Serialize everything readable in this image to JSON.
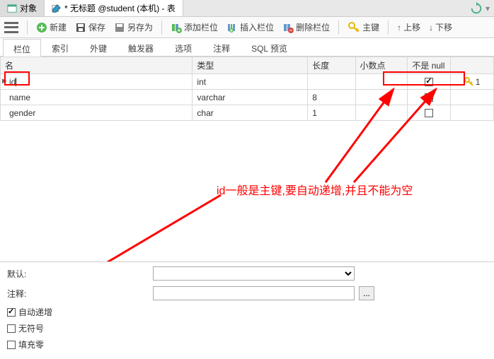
{
  "tabs": {
    "obj": "对象",
    "current": "* 无标题 @student (本机) - 表"
  },
  "toolbar": {
    "new": "新建",
    "save": "保存",
    "saveas": "另存为",
    "addcol": "添加栏位",
    "insertcol": "插入栏位",
    "delcol": "删除栏位",
    "pk": "主键",
    "moveup": "上移",
    "movedown": "下移"
  },
  "subtabs": {
    "fields": "栏位",
    "index": "索引",
    "fk": "外键",
    "trigger": "触发器",
    "options": "选项",
    "comment": "注释",
    "sql": "SQL 预览"
  },
  "headers": {
    "name": "名",
    "type": "类型",
    "len": "长度",
    "dec": "小数点",
    "nn": "不是 null"
  },
  "rows": [
    {
      "name": "id",
      "type": "int",
      "len": "",
      "dec": "",
      "nn": true,
      "pk": "1",
      "current": true
    },
    {
      "name": "name",
      "type": "varchar",
      "len": "8",
      "dec": "",
      "nn": false,
      "pk": "",
      "current": false
    },
    {
      "name": "gender",
      "type": "char",
      "len": "1",
      "dec": "",
      "nn": false,
      "pk": "",
      "current": false
    }
  ],
  "bottom": {
    "default": "默认:",
    "comment": "注释:",
    "autoinc": "自动递增",
    "unsigned": "无符号",
    "zerofill": "填充零",
    "browse": "..."
  },
  "annotation": "id一般是主键,要自动递增,并且不能为空"
}
